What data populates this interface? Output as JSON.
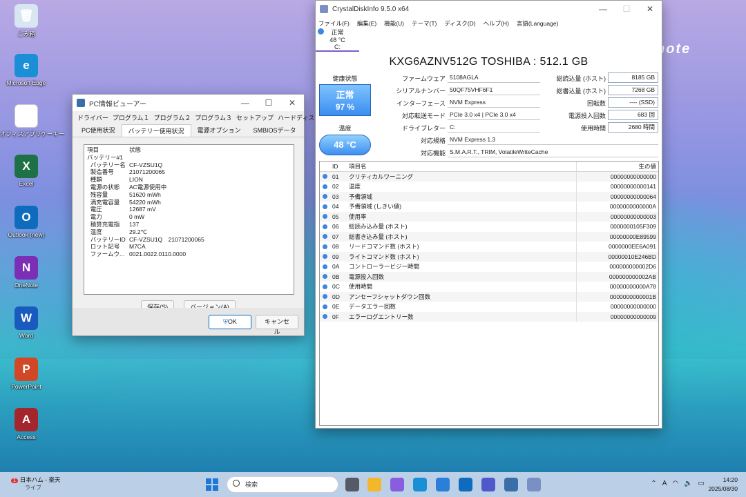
{
  "desktop": {
    "brand": "note",
    "icons": [
      {
        "label": "ごみ箱",
        "icon": "recycle-bin-icon",
        "color": "#d8e6f2",
        "glyph": "🗑"
      },
      {
        "label": "Microsoft Edge",
        "icon": "edge-icon",
        "color": "#1b8fd6",
        "glyph": "e"
      },
      {
        "label": "オフィスアプリケーキー",
        "icon": "document-icon",
        "color": "#ffffff",
        "glyph": ""
      },
      {
        "label": "Excel",
        "icon": "excel-icon",
        "color": "#1e7145",
        "glyph": "X"
      },
      {
        "label": "Outlook (new)",
        "icon": "outlook-icon",
        "color": "#0f6cbd",
        "glyph": "O"
      },
      {
        "label": "OneNote",
        "icon": "onenote-icon",
        "color": "#7b2fb5",
        "glyph": "N"
      },
      {
        "label": "Word",
        "icon": "word-icon",
        "color": "#185abd",
        "glyph": "W"
      },
      {
        "label": "PowerPoint",
        "icon": "powerpoint-icon",
        "color": "#d24726",
        "glyph": "P"
      },
      {
        "label": "Access",
        "icon": "access-icon",
        "color": "#a4262c",
        "glyph": "A"
      }
    ]
  },
  "pcinfo": {
    "title": "PC情報ビューアー",
    "tabs_row1": [
      "ドライバー",
      "プログラム１",
      "プログラム２",
      "プログラム３",
      "セットアップ",
      "ハードディスク使用状況"
    ],
    "tabs_row2": [
      "PC使用状況",
      "バッテリー使用状況",
      "電源オプション",
      "SMBIOSデータ"
    ],
    "active_tab": "バッテリー使用状況",
    "columns": [
      "項目",
      "状態"
    ],
    "rows": [
      {
        "k": "バッテリー#1",
        "v": ""
      },
      {
        "k": "  バッテリー名",
        "v": "CF-VZSU1Q"
      },
      {
        "k": "  製造番号",
        "v": "21071200065"
      },
      {
        "k": "  種類",
        "v": "LION"
      },
      {
        "k": "  電源の状態",
        "v": "AC電源使用中"
      },
      {
        "k": "  残容量",
        "v": "51620 mWh"
      },
      {
        "k": "  満充電容量",
        "v": "54220 mWh"
      },
      {
        "k": "  電圧",
        "v": "12687 mV"
      },
      {
        "k": "  電力",
        "v": "0 mW"
      },
      {
        "k": "  積算充電指",
        "v": "137"
      },
      {
        "k": "  温度",
        "v": "29.2℃"
      },
      {
        "k": "  バッテリーID",
        "v": "CF-VZSU1Q　21071200065"
      },
      {
        "k": "  ロット記号",
        "v": "M7CA"
      },
      {
        "k": "  ファームウ...",
        "v": "0021.0022.0110.0000"
      }
    ],
    "save_label": "保存(S)",
    "version_label": "バージョン(A)",
    "ok_label": "OK",
    "cancel_label": "キャンセル"
  },
  "cdi": {
    "title": "CrystalDiskInfo 9.5.0 x64",
    "menu": [
      "ファイル(F)",
      "編集(E)",
      "機能(U)",
      "テーマ(T)",
      "ディスク(D)",
      "ヘルプ(H)",
      "言語(Language)"
    ],
    "drive_tab": {
      "status": "正常",
      "temp": "48 °C",
      "letter": "C:"
    },
    "model": "KXG6AZNV512G TOSHIBA : 512.1 GB",
    "health_label": "健康状態",
    "health_status": "正常",
    "health_percent": "97 %",
    "temp_label": "温度",
    "temp_value": "48 °C",
    "info": {
      "firmware_label": "ファームウェア",
      "firmware": "5108AGLA",
      "serial_label": "シリアルナンバー",
      "serial": "50QF75VHF6F1",
      "interface_label": "インターフェース",
      "interface": "NVM Express",
      "transfer_label": "対応転送モード",
      "transfer": "PCIe 3.0 x4 | PCIe 3.0 x4",
      "drive_letter_label": "ドライブレター",
      "drive_letter": "C:",
      "standard_label": "対応規格",
      "standard": "NVM Express 1.3",
      "features_label": "対応機能",
      "features": "S.M.A.R.T., TRIM, VolatileWriteCache"
    },
    "stats": {
      "total_read_label": "総読込量 (ホスト)",
      "total_read": "8185 GB",
      "total_write_label": "総書込量 (ホスト)",
      "total_write": "7268 GB",
      "rotation_label": "回転数",
      "rotation": "---- (SSD)",
      "power_count_label": "電源投入回数",
      "power_count": "683 回",
      "power_hours_label": "使用時間",
      "power_hours": "2680 時間"
    },
    "smart_headers": {
      "id": "ID",
      "name": "項目名",
      "raw": "生の値"
    },
    "smart": [
      {
        "id": "01",
        "name": "クリティカルワーニング",
        "raw": "00000000000000"
      },
      {
        "id": "02",
        "name": "温度",
        "raw": "00000000000141"
      },
      {
        "id": "03",
        "name": "予備領域",
        "raw": "00000000000064"
      },
      {
        "id": "04",
        "name": "予備領域 (しきい値)",
        "raw": "0000000000000A"
      },
      {
        "id": "05",
        "name": "使用率",
        "raw": "00000000000003"
      },
      {
        "id": "06",
        "name": "総読み込み量 (ホスト)",
        "raw": "0000000105F309"
      },
      {
        "id": "07",
        "name": "総書き込み量 (ホスト)",
        "raw": "00000000E89599"
      },
      {
        "id": "08",
        "name": "リードコマンド数 (ホスト)",
        "raw": "0000000EE6A091"
      },
      {
        "id": "09",
        "name": "ライトコマンド数 (ホスト)",
        "raw": "00000010E246BD"
      },
      {
        "id": "0A",
        "name": "コントローラービジー時間",
        "raw": "000000000002D6"
      },
      {
        "id": "0B",
        "name": "電源投入回数",
        "raw": "000000000002AB"
      },
      {
        "id": "0C",
        "name": "使用時間",
        "raw": "00000000000A78"
      },
      {
        "id": "0D",
        "name": "アンセーフシャットダウン回数",
        "raw": "0000000000001B"
      },
      {
        "id": "0E",
        "name": "データエラー回数",
        "raw": "00000000000000"
      },
      {
        "id": "0F",
        "name": "エラーログエントリー数",
        "raw": "00000000000009"
      }
    ]
  },
  "taskbar": {
    "news_title": "日本ハム - 楽天",
    "news_sub": "ライブ",
    "news_badge": "1",
    "search_placeholder": "検索",
    "apps": [
      {
        "icon": "task-view-icon",
        "color": "#555a66"
      },
      {
        "icon": "file-explorer-icon",
        "color": "#f3b72b"
      },
      {
        "icon": "copilot-icon",
        "color": "#8a5ce0"
      },
      {
        "icon": "edge-icon",
        "color": "#1b8fd6"
      },
      {
        "icon": "microsoft-store-icon",
        "color": "#2b7fd8"
      },
      {
        "icon": "outlook-icon",
        "color": "#0f6cbd"
      },
      {
        "icon": "teams-icon",
        "color": "#5059c9"
      },
      {
        "icon": "pc-info-viewer-icon",
        "color": "#3a6ea8"
      },
      {
        "icon": "crystaldiskinfo-icon",
        "color": "#7a8fc4"
      }
    ],
    "ime": "A",
    "time": "14:20",
    "date": "2025/08/30"
  }
}
